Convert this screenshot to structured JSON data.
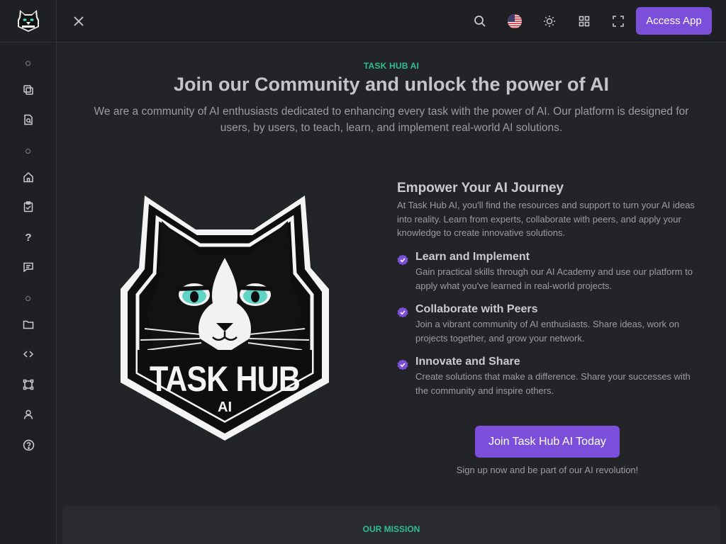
{
  "header": {
    "close_icon": "close-icon",
    "search_icon": "search-icon",
    "language_icon": "us-flag-icon",
    "theme_icon": "sun-icon",
    "apps_icon": "grid-icon",
    "fullscreen_icon": "fullscreen-icon",
    "access_button": "Access App"
  },
  "sidebar": {
    "logo": "task-hub-ai-logo",
    "items": [
      "copy-icon",
      "search-file-icon",
      "home-icon",
      "clipboard-check-icon",
      "help-icon",
      "chat-icon",
      "folder-icon",
      "code-icon",
      "network-icon",
      "user-icon",
      "help-circle-icon"
    ]
  },
  "hero": {
    "eyebrow": "TASK HUB AI",
    "title": "Join our Community and unlock the power of AI",
    "subtitle": "We are a community of AI enthusiasts dedicated to enhancing every task with the power of AI. Our platform is designed for users, by users, to teach, learn, and implement real-world AI solutions."
  },
  "logo": {
    "line1": "TASK HUB",
    "line2": "AI"
  },
  "journey": {
    "title": "Empower Your AI Journey",
    "description": "At Task Hub AI, you'll find the resources and support to turn your AI ideas into reality. Learn from experts, collaborate with peers, and apply your knowledge to create innovative solutions.",
    "features": [
      {
        "title": "Learn and Implement",
        "description": "Gain practical skills through our AI Academy and use our platform to apply what you've learned in real-world projects."
      },
      {
        "title": "Collaborate with Peers",
        "description": "Join a vibrant community of AI enthusiasts. Share ideas, work on projects together, and grow your network."
      },
      {
        "title": "Innovate and Share",
        "description": "Create solutions that make a difference. Share your successes with the community and inspire others."
      }
    ],
    "cta": "Join Task Hub AI Today",
    "cta_note": "Sign up now and be part of our AI revolution!"
  },
  "mission": {
    "eyebrow": "OUR MISSION"
  },
  "colors": {
    "accent": "#7b4fd9",
    "eyebrow": "#2fbf8f",
    "background": "#232427",
    "sidebar": "#1f2023"
  }
}
